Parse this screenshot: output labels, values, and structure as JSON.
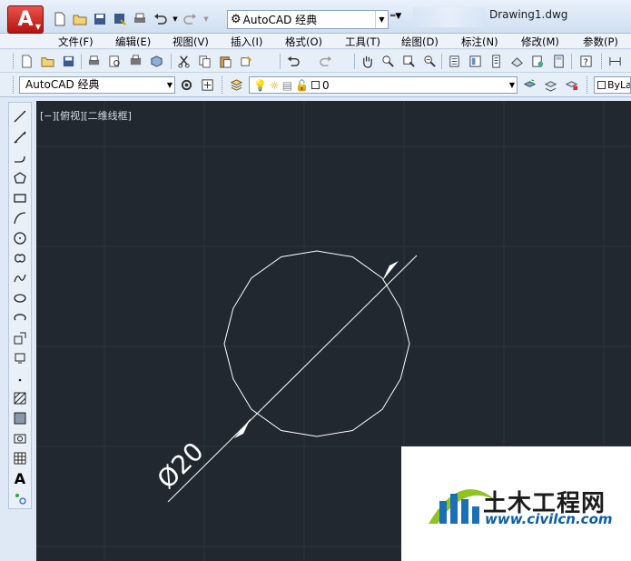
{
  "app": {
    "logo_letter": "A",
    "document_title": "Drawing1.dwg"
  },
  "titlebar": {
    "workspace_value": "AutoCAD 经典"
  },
  "menu": [
    {
      "label": "文件(F)"
    },
    {
      "label": "编辑(E)"
    },
    {
      "label": "视图(V)"
    },
    {
      "label": "插入(I)"
    },
    {
      "label": "格式(O)"
    },
    {
      "label": "工具(T)"
    },
    {
      "label": "绘图(D)"
    },
    {
      "label": "标注(N)"
    },
    {
      "label": "修改(M)"
    },
    {
      "label": "参数(P)"
    }
  ],
  "toolbar2": {
    "workspace_select": "AutoCAD 经典",
    "layer_value": "0",
    "color_value": "ByLa"
  },
  "canvas": {
    "viewport_label": "[−][俯视][二维线框]",
    "dimension_text": "Ø20",
    "background": "#212830",
    "grid_color": "#2b333d",
    "line_color": "#ffffff"
  },
  "watermark": {
    "brand": "土木工程网",
    "url": "www.civilcn.com"
  },
  "colors": {
    "accent_red": "#c0201a",
    "toolbar_bg": "#e6eef8"
  }
}
